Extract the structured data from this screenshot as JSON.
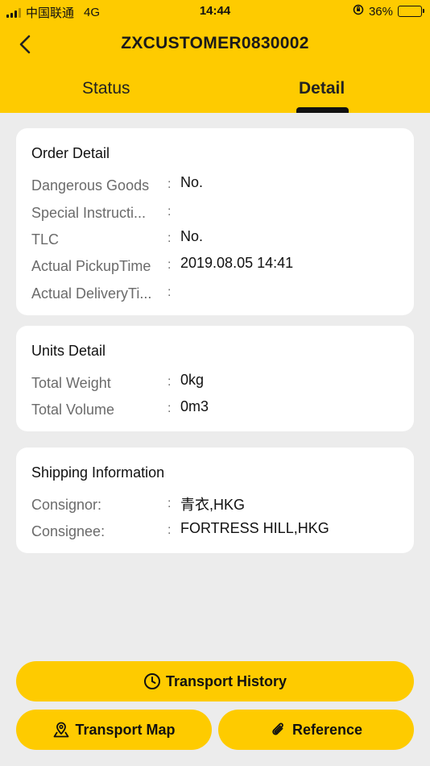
{
  "status_bar": {
    "carrier": "中国联通",
    "network": "4G",
    "time": "14:44",
    "battery": "36%"
  },
  "header": {
    "title": "ZXCUSTOMER0830002"
  },
  "tabs": [
    {
      "label": "Status"
    },
    {
      "label": "Detail",
      "active": true
    }
  ],
  "order_detail": {
    "title": "Order Detail",
    "rows": [
      {
        "label": "Dangerous Goods",
        "value": "No."
      },
      {
        "label": "Special Instructi...",
        "value": ""
      },
      {
        "label": "TLC",
        "value": "No."
      },
      {
        "label": "Actual PickupTime",
        "value": "2019.08.05 14:41"
      },
      {
        "label": "Actual DeliveryTi...",
        "value": ""
      }
    ]
  },
  "units_detail": {
    "title": "Units Detail",
    "rows": [
      {
        "label": "Total Weight",
        "value": "0kg"
      },
      {
        "label": "Total Volume",
        "value": "0m3"
      }
    ]
  },
  "shipping_info": {
    "title": "Shipping Information",
    "rows": [
      {
        "label": "Consignor:",
        "value": "青衣,HKG"
      },
      {
        "label": "Consignee:",
        "value": "FORTRESS HILL,HKG"
      }
    ]
  },
  "colon": ":",
  "buttons": {
    "transport_history": "Transport History",
    "transport_map": "Transport Map",
    "reference": "Reference"
  },
  "colors": {
    "accent": "#fecb00",
    "background": "#ececec",
    "card": "#ffffff"
  },
  "icons": {
    "back": "chevron-left-icon",
    "history": "clock-icon",
    "map": "map-pin-icon",
    "reference": "paperclip-icon"
  }
}
